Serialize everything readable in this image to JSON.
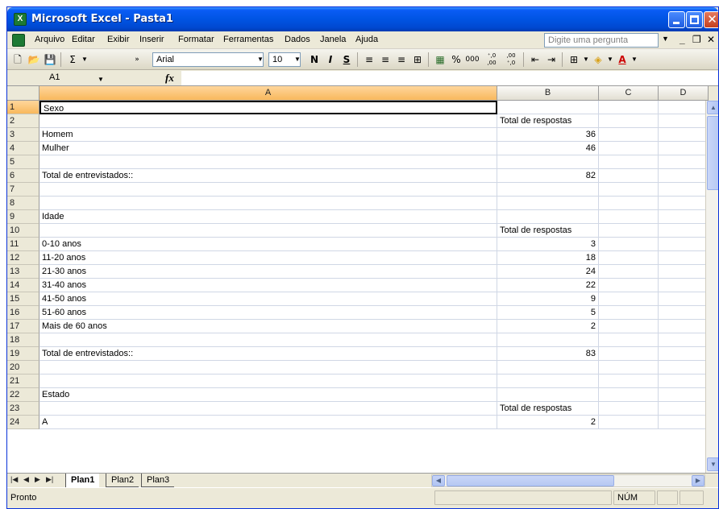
{
  "window": {
    "title": "Microsoft Excel - Pasta1",
    "app_icon_letter": "X"
  },
  "menu": {
    "items": [
      {
        "label": "Arquivo"
      },
      {
        "label": "Editar"
      },
      {
        "label": "Exibir"
      },
      {
        "label": "Inserir"
      },
      {
        "label": "Formatar"
      },
      {
        "label": "Ferramentas"
      },
      {
        "label": "Dados"
      },
      {
        "label": "Janela"
      },
      {
        "label": "Ajuda"
      }
    ],
    "ask_placeholder": "Digite uma pergunta"
  },
  "toolbar": {
    "font_name": "Arial",
    "font_size": "10",
    "bold": "N",
    "italic": "I",
    "underline": "S",
    "percent": "%",
    "thousands": "000",
    "inc_decimal": "⁺,0 ,00",
    "dec_decimal": ",00 ⁺,0"
  },
  "formula_bar": {
    "cell_ref": "A1",
    "fx": "fx",
    "content": ""
  },
  "columns": [
    "A",
    "B",
    "C",
    "D"
  ],
  "rows": [
    {
      "n": "1",
      "a": "Sexo",
      "b": ""
    },
    {
      "n": "2",
      "a": "",
      "b": "Total de respostas"
    },
    {
      "n": "3",
      "a": "Homem",
      "b": "36"
    },
    {
      "n": "4",
      "a": "Mulher",
      "b": "46"
    },
    {
      "n": "5",
      "a": "",
      "b": ""
    },
    {
      "n": "6",
      "a": "Total de entrevistados::",
      "b": "82"
    },
    {
      "n": "7",
      "a": "",
      "b": ""
    },
    {
      "n": "8",
      "a": "",
      "b": ""
    },
    {
      "n": "9",
      "a": "Idade",
      "b": ""
    },
    {
      "n": "10",
      "a": "",
      "b": "Total de respostas"
    },
    {
      "n": "11",
      "a": "0-10 anos",
      "b": "3"
    },
    {
      "n": "12",
      "a": "11-20 anos",
      "b": "18"
    },
    {
      "n": "13",
      "a": "21-30 anos",
      "b": "24"
    },
    {
      "n": "14",
      "a": "31-40 anos",
      "b": "22"
    },
    {
      "n": "15",
      "a": "41-50 anos",
      "b": "9"
    },
    {
      "n": "16",
      "a": "51-60 anos",
      "b": "5"
    },
    {
      "n": "17",
      "a": "Mais de 60 anos",
      "b": "2"
    },
    {
      "n": "18",
      "a": "",
      "b": ""
    },
    {
      "n": "19",
      "a": "Total de entrevistados::",
      "b": "83"
    },
    {
      "n": "20",
      "a": "",
      "b": ""
    },
    {
      "n": "21",
      "a": "",
      "b": ""
    },
    {
      "n": "22",
      "a": "Estado",
      "b": ""
    },
    {
      "n": "23",
      "a": "",
      "b": "Total de respostas"
    },
    {
      "n": "24",
      "a": "A",
      "b": "2"
    }
  ],
  "sheets": [
    "Plan1",
    "Plan2",
    "Plan3"
  ],
  "active_sheet": "Plan1",
  "status": {
    "ready": "Pronto",
    "num": "NÚM"
  }
}
